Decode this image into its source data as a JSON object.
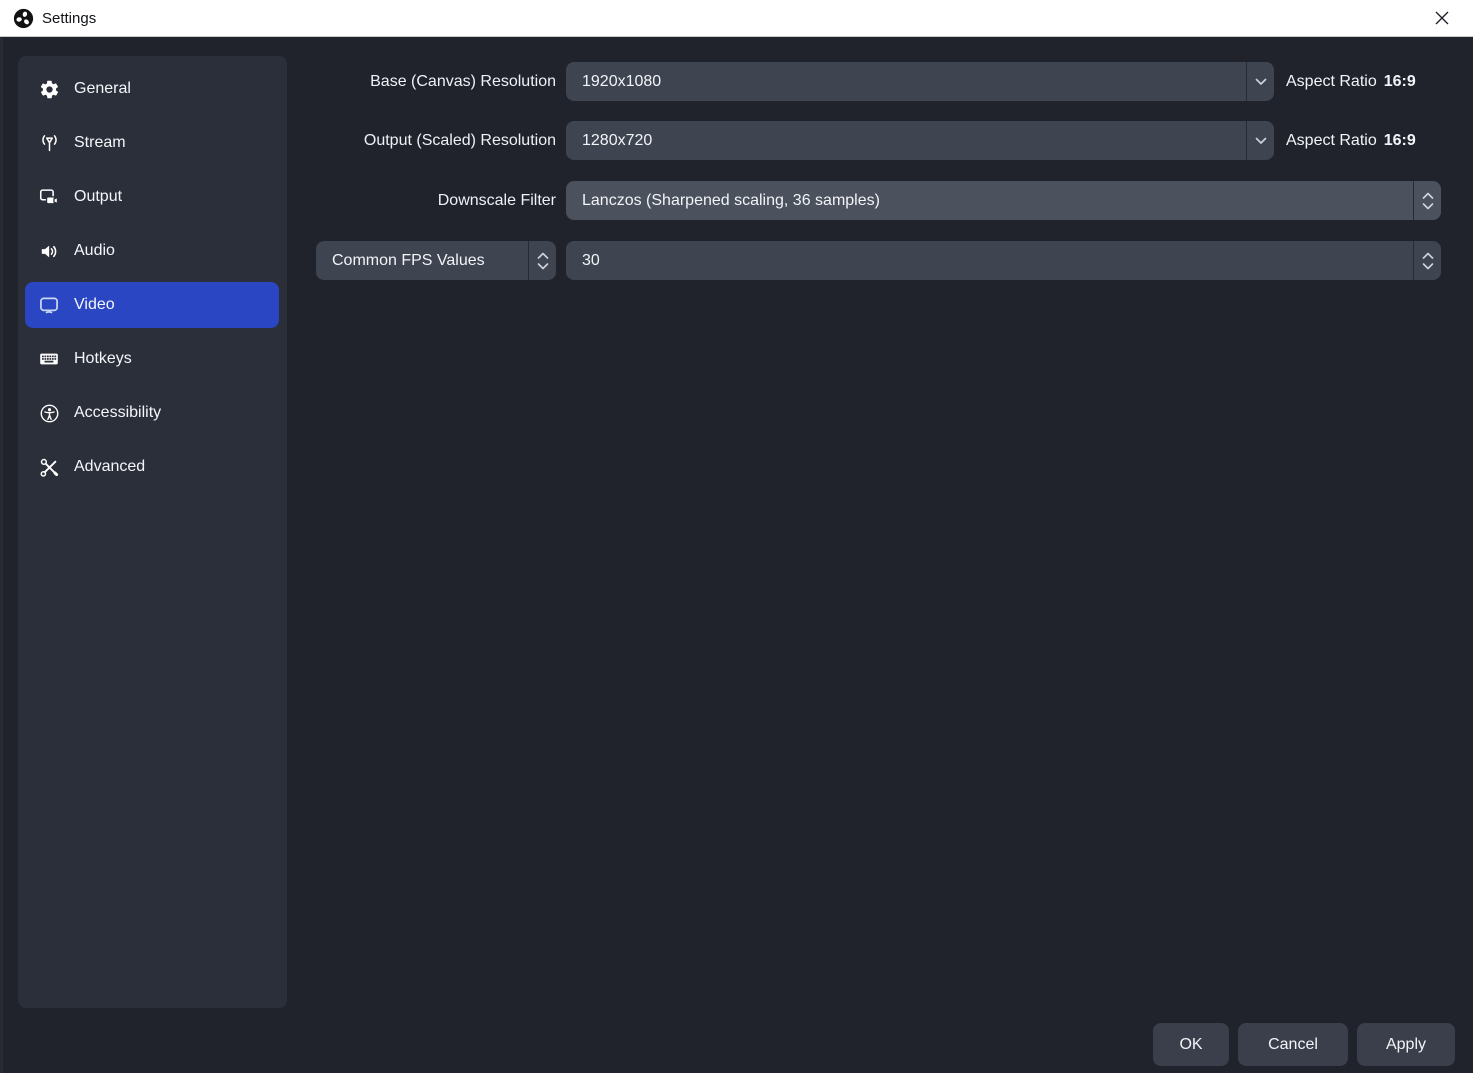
{
  "window": {
    "title": "Settings"
  },
  "sidebar": {
    "items": [
      {
        "label": "General",
        "icon": "gear-icon",
        "selected": false
      },
      {
        "label": "Stream",
        "icon": "broadcast-icon",
        "selected": false
      },
      {
        "label": "Output",
        "icon": "output-icon",
        "selected": false
      },
      {
        "label": "Audio",
        "icon": "speaker-icon",
        "selected": false
      },
      {
        "label": "Video",
        "icon": "monitor-icon",
        "selected": true
      },
      {
        "label": "Hotkeys",
        "icon": "keyboard-icon",
        "selected": false
      },
      {
        "label": "Accessibility",
        "icon": "accessibility-icon",
        "selected": false
      },
      {
        "label": "Advanced",
        "icon": "tools-icon",
        "selected": false
      }
    ]
  },
  "form": {
    "base_resolution": {
      "label": "Base (Canvas) Resolution",
      "value": "1920x1080",
      "aspect_ratio_label": "Aspect Ratio",
      "aspect_ratio_value": "16:9"
    },
    "output_resolution": {
      "label": "Output (Scaled) Resolution",
      "value": "1280x720",
      "aspect_ratio_label": "Aspect Ratio",
      "aspect_ratio_value": "16:9"
    },
    "downscale_filter": {
      "label": "Downscale Filter",
      "value": "Lanczos (Sharpened scaling, 36 samples)"
    },
    "fps": {
      "type_value": "Common FPS Values",
      "value": "30"
    }
  },
  "footer": {
    "ok_label": "OK",
    "cancel_label": "Cancel",
    "apply_label": "Apply"
  },
  "colors": {
    "accent_selected": "#2b46c2",
    "titlebar_bg": "#ffffff",
    "window_bg": "#20232c",
    "sidebar_bg": "#2b2f3a",
    "input_bg": "#3e4450",
    "input_bg_light": "#4b515d",
    "button_bg": "#3a3f4b"
  }
}
